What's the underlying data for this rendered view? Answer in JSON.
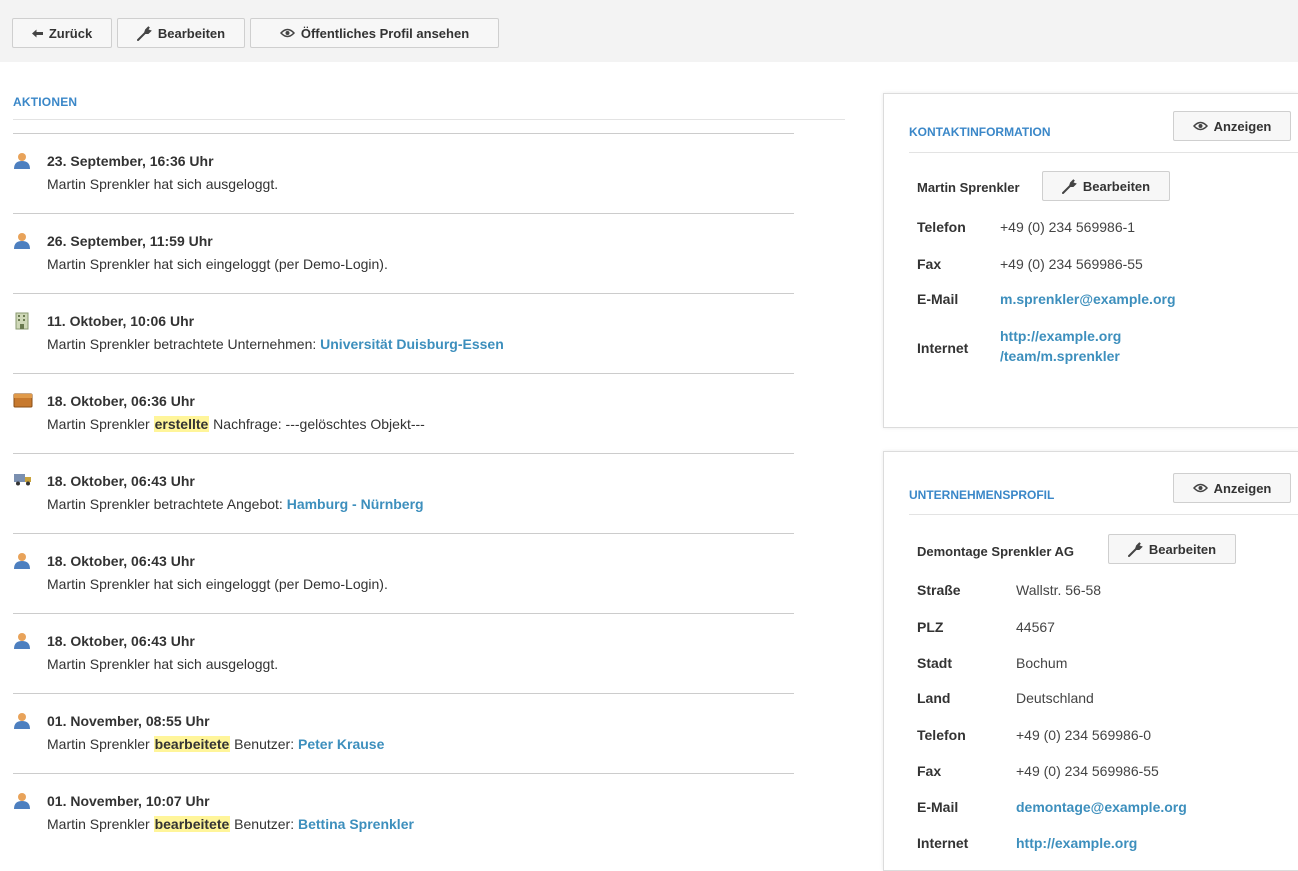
{
  "toolbar": {
    "back_label": "Zurück",
    "edit_label": "Bearbeiten",
    "public_profile_label": "Öffentliches Profil ansehen"
  },
  "aktionen": {
    "title": "AKTIONEN",
    "items": [
      {
        "icon": "user-icon",
        "date": "23. September, 16:36 Uhr",
        "pre": "Martin Sprenkler hat sich ausgeloggt.",
        "highlight": "",
        "mid": "",
        "link": ""
      },
      {
        "icon": "user-icon",
        "date": "26. September, 11:59 Uhr",
        "pre": "Martin Sprenkler hat sich eingeloggt (per Demo-Login).",
        "highlight": "",
        "mid": "",
        "link": ""
      },
      {
        "icon": "building-icon",
        "date": "11. Oktober, 10:06 Uhr",
        "pre": "Martin Sprenkler betrachtete Unternehmen: ",
        "highlight": "",
        "mid": "",
        "link": "Universität Duisburg-Essen"
      },
      {
        "icon": "box-icon",
        "date": "18. Oktober, 06:36 Uhr",
        "pre": "Martin Sprenkler ",
        "highlight": "erstellte",
        "mid": " Nachfrage: ---gelöschtes Objekt---",
        "link": ""
      },
      {
        "icon": "truck-icon",
        "date": "18. Oktober, 06:43 Uhr",
        "pre": "Martin Sprenkler betrachtete Angebot: ",
        "highlight": "",
        "mid": "",
        "link": "Hamburg - Nürnberg"
      },
      {
        "icon": "user-icon",
        "date": "18. Oktober, 06:43 Uhr",
        "pre": "Martin Sprenkler hat sich eingeloggt (per Demo-Login).",
        "highlight": "",
        "mid": "",
        "link": ""
      },
      {
        "icon": "user-icon",
        "date": "18. Oktober, 06:43 Uhr",
        "pre": "Martin Sprenkler hat sich ausgeloggt.",
        "highlight": "",
        "mid": "",
        "link": ""
      },
      {
        "icon": "user-icon",
        "date": "01. November, 08:55 Uhr",
        "pre": "Martin Sprenkler ",
        "highlight": "bearbeitete",
        "mid": " Benutzer: ",
        "link": "Peter Krause"
      },
      {
        "icon": "user-icon",
        "date": "01. November, 10:07 Uhr",
        "pre": "Martin Sprenkler ",
        "highlight": "bearbeitete",
        "mid": " Benutzer: ",
        "link": "Bettina Sprenkler"
      }
    ]
  },
  "kontakt": {
    "title": "KONTAKTINFORMATION",
    "show_label": "Anzeigen",
    "name": "Martin Sprenkler",
    "edit_label": "Bearbeiten",
    "telefon_label": "Telefon",
    "telefon": "+49 (0) 234 569986-1",
    "fax_label": "Fax",
    "fax": "+49 (0) 234 569986-55",
    "email_label": "E-Mail",
    "email": "m.sprenkler@example.org",
    "internet_label": "Internet",
    "internet_line1": "http://example.org",
    "internet_line2": "/team/m.sprenkler"
  },
  "unternehmen": {
    "title": "UNTERNEHMENSPROFIL",
    "show_label": "Anzeigen",
    "name": "Demontage Sprenkler AG",
    "edit_label": "Bearbeiten",
    "strasse_label": "Straße",
    "strasse": "Wallstr. 56-58",
    "plz_label": "PLZ",
    "plz": "44567",
    "stadt_label": "Stadt",
    "stadt": "Bochum",
    "land_label": "Land",
    "land": "Deutschland",
    "telefon_label": "Telefon",
    "telefon": "+49 (0) 234 569986-0",
    "fax_label": "Fax",
    "fax": "+49 (0) 234 569986-55",
    "email_label": "E-Mail",
    "email": "demontage@example.org",
    "internet_label": "Internet",
    "internet": "http://example.org"
  }
}
